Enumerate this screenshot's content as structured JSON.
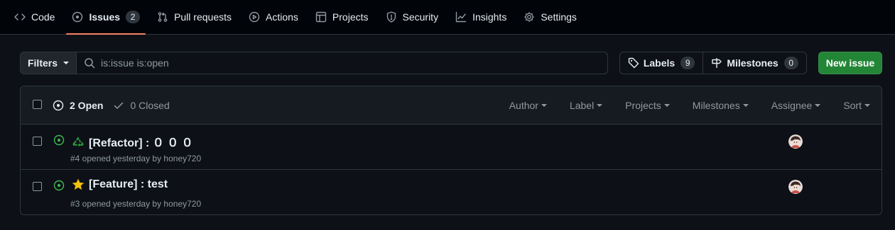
{
  "repo_nav": {
    "tabs": [
      {
        "label": "Code",
        "icon": "code-icon"
      },
      {
        "label": "Issues",
        "icon": "issue-opened-icon",
        "count": "2",
        "selected": true
      },
      {
        "label": "Pull requests",
        "icon": "git-pull-request-icon"
      },
      {
        "label": "Actions",
        "icon": "play-icon"
      },
      {
        "label": "Projects",
        "icon": "table-icon"
      },
      {
        "label": "Security",
        "icon": "shield-icon"
      },
      {
        "label": "Insights",
        "icon": "graph-icon"
      },
      {
        "label": "Settings",
        "icon": "gear-icon"
      }
    ]
  },
  "subnav": {
    "filters_label": "Filters",
    "search_value": "is:issue is:open",
    "labels_label": "Labels",
    "labels_count": "9",
    "milestones_label": "Milestones",
    "milestones_count": "0",
    "new_issue_label": "New issue"
  },
  "issues_header": {
    "open_label": "2 Open",
    "closed_label": "0 Closed",
    "filters": [
      "Author",
      "Label",
      "Projects",
      "Milestones",
      "Assignee",
      "Sort"
    ]
  },
  "issues": [
    {
      "emoji": "recycle-icon",
      "title": "[Refactor] : ０ ０ ０",
      "meta": "#4 opened yesterday by honey720"
    },
    {
      "emoji": "star-icon",
      "title": "[Feature] : test",
      "meta": "#3 opened yesterday by honey720"
    }
  ],
  "colors": {
    "background": "#0d1117",
    "nav_background": "#010409",
    "border": "#30363d",
    "open_green": "#3fb950",
    "primary_button": "#238636",
    "selected_underline": "#f78166",
    "muted_text": "#9198a1"
  }
}
